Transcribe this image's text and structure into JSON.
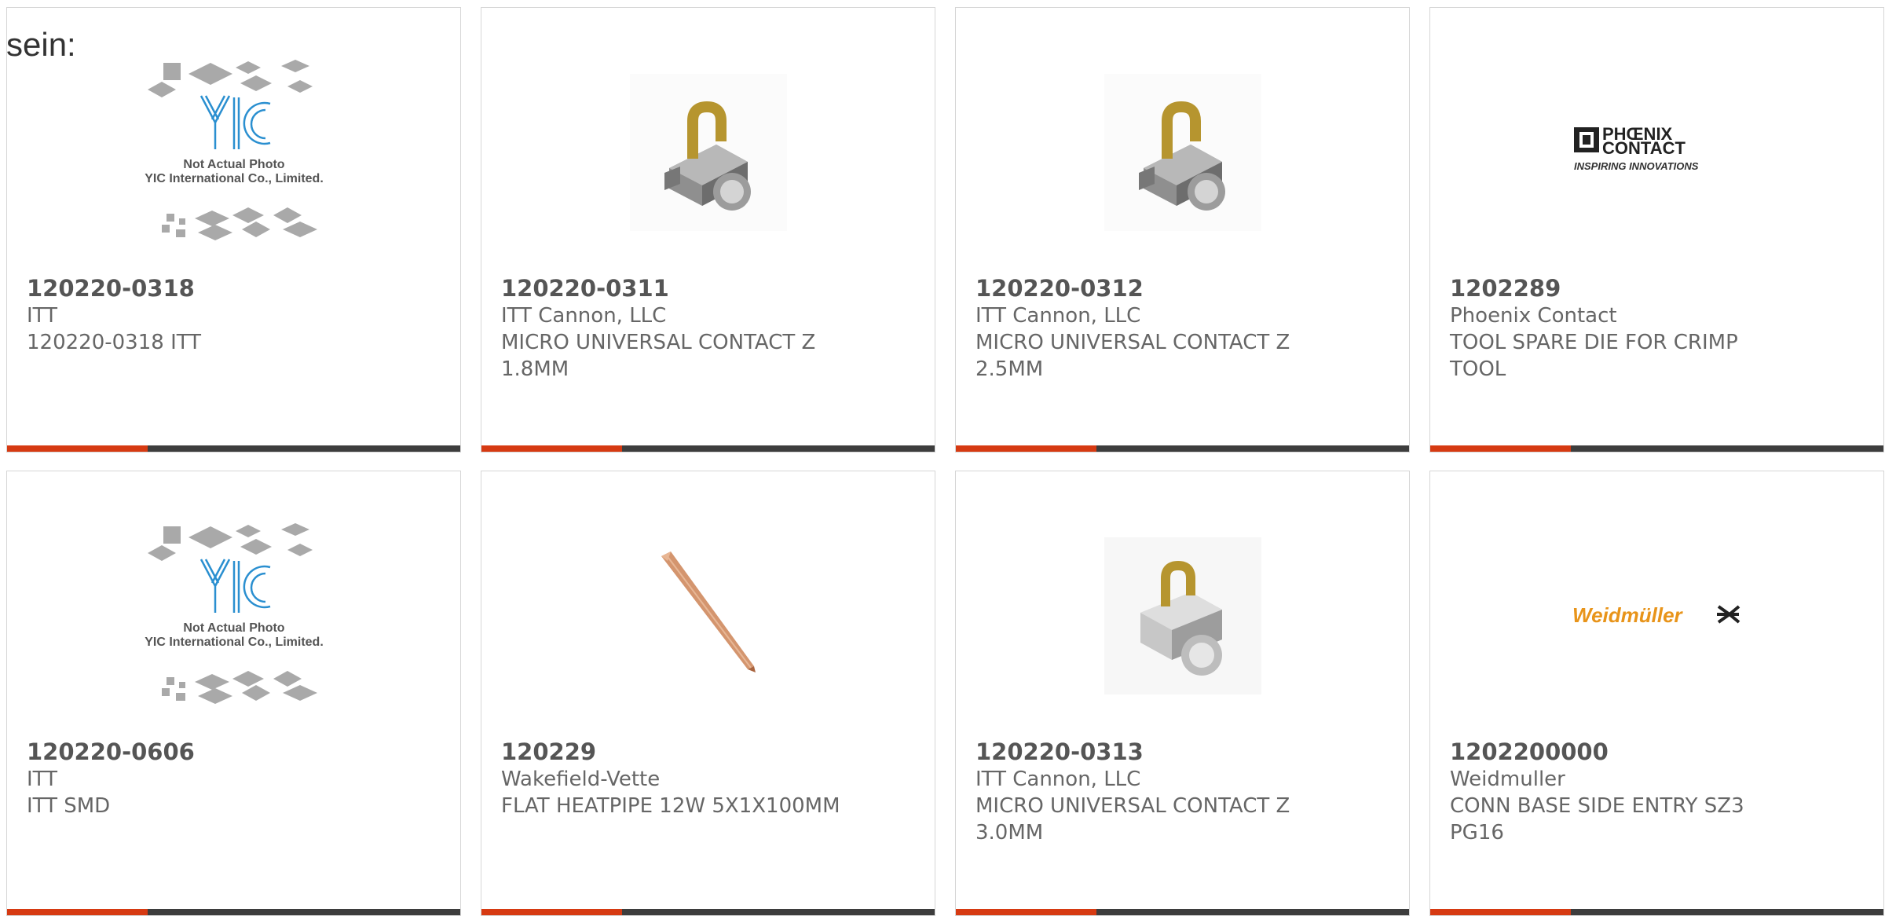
{
  "intro_text": "sein:",
  "placeholder": {
    "line1": "Not Actual Photo",
    "line2": "YIC International Co., Limited.",
    "logo": "YIC"
  },
  "logos": {
    "phoenix_line1": "PHŒNIX",
    "phoenix_line2": "CONTACT",
    "phoenix_tagline": "INSPIRING INNOVATIONS",
    "weidmuller": "Weidmüller"
  },
  "colors": {
    "accent": "#d63a12",
    "bar": "#3d3d3d",
    "border": "#d6d6d6"
  },
  "products": [
    {
      "part": "120220-0318",
      "manufacturer": "ITT",
      "desc1": "120220-0318 ITT",
      "desc2": "",
      "image": "placeholder-image"
    },
    {
      "part": "120220-0311",
      "manufacturer": "ITT Cannon, LLC",
      "desc1": "MICRO UNIVERSAL CONTACT Z",
      "desc2": "1.8MM",
      "image": "contact-photo"
    },
    {
      "part": "120220-0312",
      "manufacturer": "ITT Cannon, LLC",
      "desc1": "MICRO UNIVERSAL CONTACT Z",
      "desc2": "2.5MM",
      "image": "contact-photo"
    },
    {
      "part": "1202289",
      "manufacturer": "Phoenix Contact",
      "desc1": "TOOL SPARE DIE FOR CRIMP",
      "desc2": "TOOL",
      "image": "phoenix-contact-logo"
    },
    {
      "part": "120220-0606",
      "manufacturer": "ITT",
      "desc1": "ITT SMD",
      "desc2": "",
      "image": "placeholder-image"
    },
    {
      "part": "120229",
      "manufacturer": "Wakefield-Vette",
      "desc1": "FLAT HEATPIPE 12W 5X1X100MM",
      "desc2": "",
      "image": "heatpipe-photo"
    },
    {
      "part": "120220-0313",
      "manufacturer": "ITT Cannon, LLC",
      "desc1": "MICRO UNIVERSAL CONTACT Z",
      "desc2": "3.0MM",
      "image": "contact-photo"
    },
    {
      "part": "1202200000",
      "manufacturer": "Weidmuller",
      "desc1": "CONN BASE SIDE ENTRY SZ3",
      "desc2": "PG16",
      "image": "weidmuller-logo"
    }
  ]
}
